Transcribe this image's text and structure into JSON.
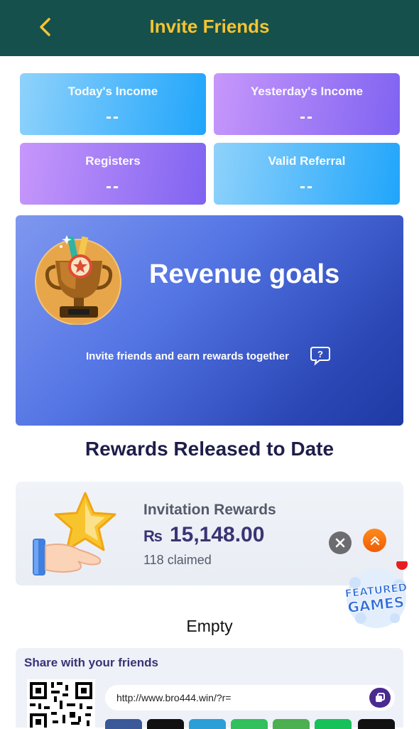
{
  "header": {
    "title": "Invite Friends",
    "back_icon": "chevron-left-icon"
  },
  "stats": [
    {
      "label": "Today's Income",
      "value": "--"
    },
    {
      "label": "Yesterday's Income",
      "value": "--"
    },
    {
      "label": "Registers",
      "value": "--"
    },
    {
      "label": "Valid Referral",
      "value": "--"
    }
  ],
  "goals": {
    "title": "Revenue goals",
    "subtitle": "Invite friends and earn rewards together",
    "help_icon": "?"
  },
  "released": {
    "title": "Rewards Released to Date"
  },
  "reward": {
    "name": "Invitation Rewards",
    "currency": "₨",
    "amount": "15,148.00",
    "claimed": "118 claimed"
  },
  "featured": {
    "line1": "FEATURED",
    "line2": "GAMES"
  },
  "empty_text": "Empty",
  "share": {
    "title": "Share with your friends",
    "link": "http://www.bro444.win/?r="
  },
  "colors": {
    "header_bg": "#15504c",
    "header_title": "#f5c331",
    "accent_orange": "#f05d06"
  }
}
